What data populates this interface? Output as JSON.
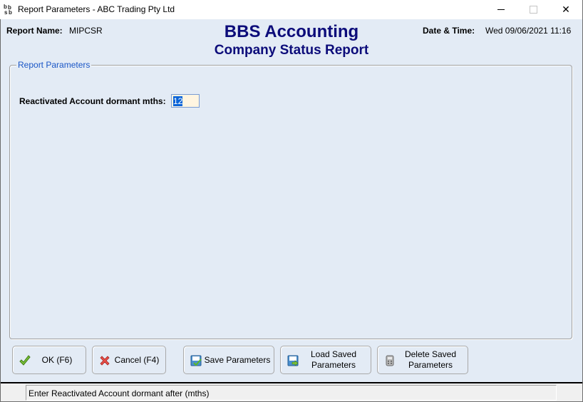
{
  "window": {
    "title": "Report Parameters - ABC Trading Pty Ltd",
    "app_icon": "bbs-logo-icon",
    "controls": {
      "minimize": "minimize-icon",
      "maximize": "maximize-icon",
      "close": "close-icon"
    },
    "close_glyph": "✕"
  },
  "header": {
    "report_name_label": "Report Name:",
    "report_name_value": "MIPCSR",
    "app_title": "BBS Accounting",
    "report_title": "Company Status Report",
    "datetime_label": "Date & Time:",
    "datetime_value": "Wed 09/06/2021 11:16"
  },
  "parameters": {
    "group_title": "Report Parameters",
    "fields": [
      {
        "label": "Reactivated Account dormant mths:",
        "value": "12"
      }
    ]
  },
  "buttons": {
    "ok": {
      "label": "OK (F6)",
      "icon": "check-icon"
    },
    "cancel": {
      "label": "Cancel (F4)",
      "icon": "x-icon"
    },
    "save": {
      "label": "Save Parameters",
      "icon": "save-params-icon"
    },
    "load": {
      "label_line1": "Load Saved",
      "label_line2": "Parameters",
      "icon": "load-params-icon"
    },
    "delete": {
      "label_line1": "Delete Saved",
      "label_line2": "Parameters",
      "icon": "delete-params-icon"
    }
  },
  "status": {
    "message": "Enter Reactivated Account dormant after (mths)"
  },
  "colors": {
    "title_blue": "#0c0c7a",
    "legend_blue": "#1a56c6",
    "background": "#e3ebf5",
    "input_bg": "#fff5e1",
    "selection": "#0a64d8"
  }
}
